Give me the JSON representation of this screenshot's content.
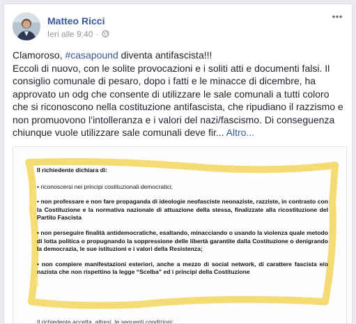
{
  "post": {
    "author": "Matteo Ricci",
    "timestamp": "Ieri alle 9:40",
    "separator": "·",
    "privacy_icon": "globe-icon",
    "more_icon": "more-options-icon",
    "text": {
      "line1_before": "Clamoroso, ",
      "hashtag": "#casapound",
      "line1_after": " diventa antifascista!!!",
      "body": "Eccoli di nuovo, con le solite provocazioni e i soliti atti e documenti falsi. Il consiglio comunale di pesaro, dopo i fatti e le minacce di dicembre, ha approvato un odg che consente di utilizzare le sale comunali a tutti coloro che si riconoscono nella costituzione antifascista, che ripudiano il razzismo e non promuovono l’intolleranza e i valori del nazi/fascismo. Di conseguenza chiunque vuole utilizzare sale comunali deve fir...",
      "more_link": "Altro..."
    }
  },
  "document": {
    "heading": "Il richiedente dichiara di:",
    "bullets": [
      "• riconoscersi nei principi costituzionali democratici;",
      "• non professare e non fare propaganda di ideologie neofasciste neonaziste, razziste, in contrasto con la Costituzione e la normativa nazionale di attuazione della stessa, finalizzate alla ricostituzione del Partito Fascista",
      "• non perseguire finalità antidemocratiche, esaltando, minacciando o usando la violenza quale metodo di lotta politica o propugnando la soppressione delle libertà garantite dalla Costituzione o denigrando la democrazia, le sue istituzioni e i valori della Resistenza;",
      "• non compiere manifestazioni esteriori, anche a mezzo di social network, di carattere fascista e/o nazista che non rispettino la legge “Scelba” ed i principi della Costituzione"
    ],
    "footer": "Il richiedente accetta, altresì, le seguenti condizioni:",
    "highlight_color": "#f2d55a"
  },
  "colors": {
    "link": "#365899",
    "text": "#1d2129",
    "meta": "#90949c"
  }
}
